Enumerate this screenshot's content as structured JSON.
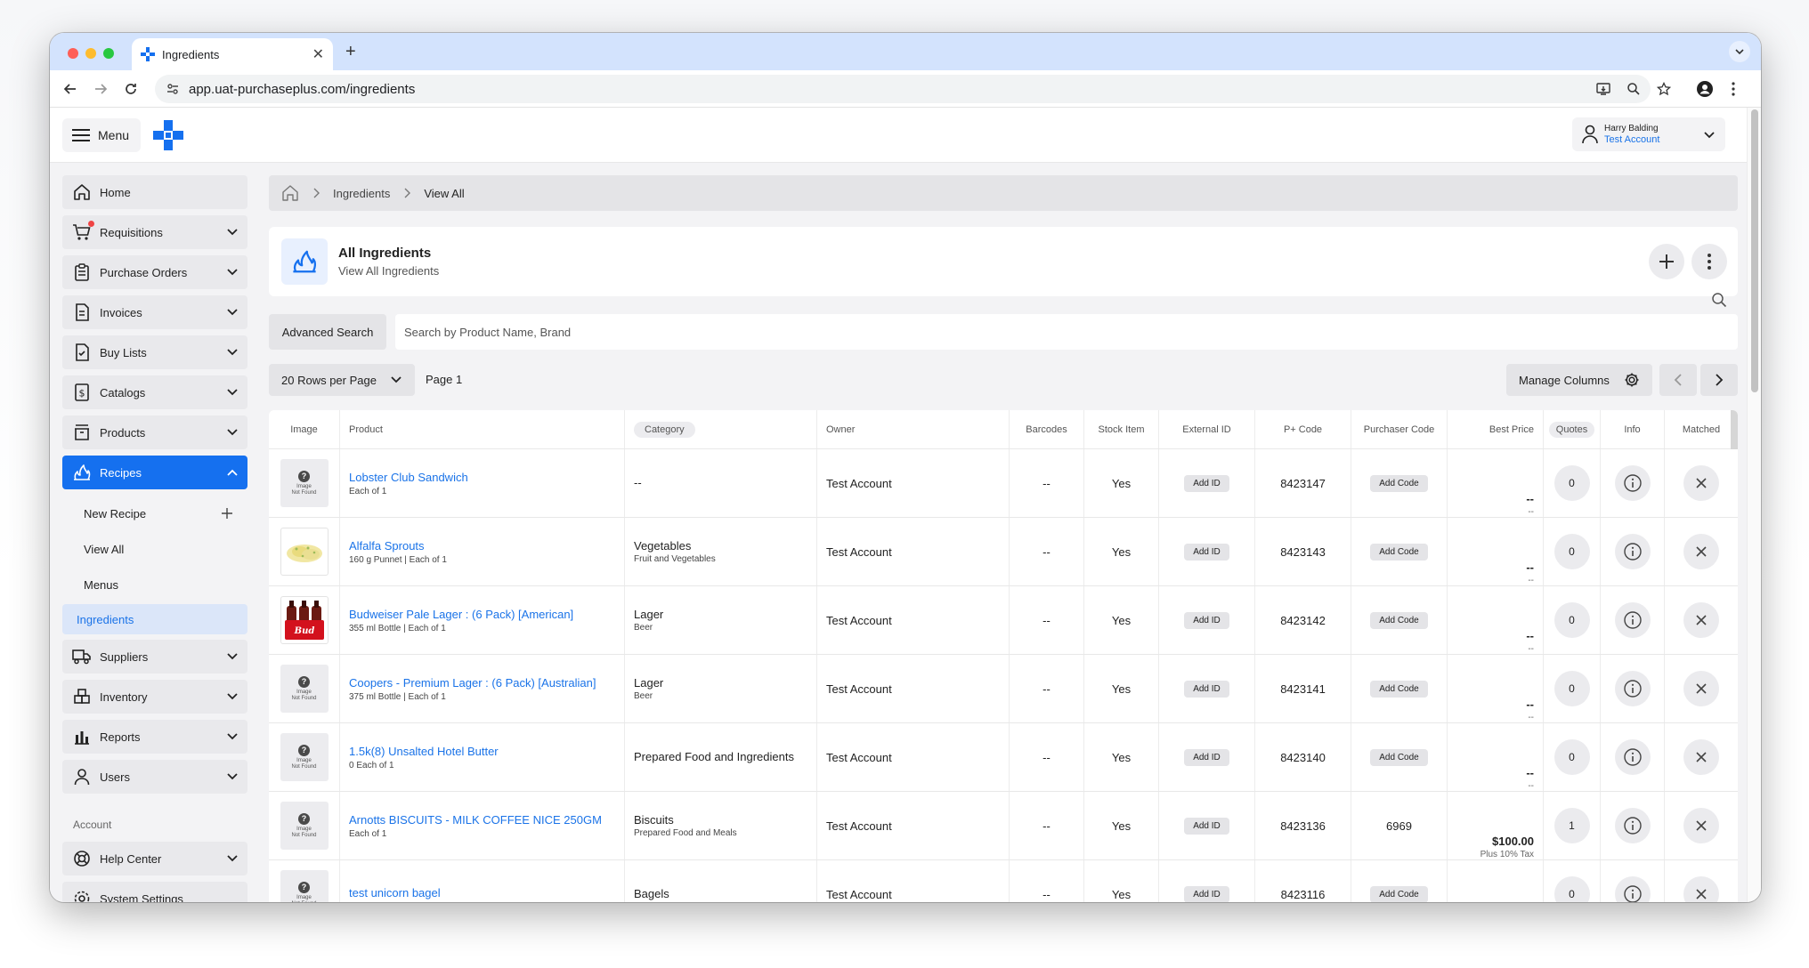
{
  "browser": {
    "tab_title": "Ingredients",
    "url": "app.uat-purchaseplus.com/ingredients"
  },
  "header": {
    "menu_label": "Menu",
    "user_name": "Harry Balding",
    "user_account": "Test Account"
  },
  "sidebar": {
    "items": [
      {
        "label": "Home",
        "icon": "home-icon"
      },
      {
        "label": "Requisitions",
        "icon": "cart-icon"
      },
      {
        "label": "Purchase Orders",
        "icon": "clipboard-icon"
      },
      {
        "label": "Invoices",
        "icon": "invoice-icon"
      },
      {
        "label": "Buy Lists",
        "icon": "checklist-icon"
      },
      {
        "label": "Catalogs",
        "icon": "dollar-doc-icon"
      },
      {
        "label": "Products",
        "icon": "box-icon"
      },
      {
        "label": "Recipes",
        "icon": "flame-icon"
      },
      {
        "label": "Suppliers",
        "icon": "truck-icon"
      },
      {
        "label": "Inventory",
        "icon": "boxes-icon"
      },
      {
        "label": "Reports",
        "icon": "bar-chart-icon"
      },
      {
        "label": "Users",
        "icon": "user-icon"
      }
    ],
    "recipes_sub": [
      "New Recipe",
      "View All",
      "Menus",
      "Ingredients"
    ],
    "account_section": "Account",
    "help_center": "Help Center",
    "partial_item": "System Settings"
  },
  "breadcrumb": {
    "level1": "Ingredients",
    "level2": "View All"
  },
  "page": {
    "title": "All Ingredients",
    "subtitle": "View All Ingredients"
  },
  "search": {
    "advanced_label": "Advanced Search",
    "placeholder": "Search by Product Name, Brand"
  },
  "pagination": {
    "rows_label": "20 Rows per Page",
    "page_label": "Page 1",
    "manage_columns": "Manage Columns"
  },
  "table": {
    "columns": {
      "image": "Image",
      "product": "Product",
      "category": "Category",
      "owner": "Owner",
      "barcodes": "Barcodes",
      "stock": "Stock Item",
      "external_id": "External ID",
      "pcode": "P+ Code",
      "purchaser_code": "Purchaser Code",
      "best_price": "Best Price",
      "quotes": "Quotes",
      "info": "Info",
      "matched": "Matched"
    },
    "rows": [
      {
        "image": "not-found",
        "name": "Lobster Club Sandwich",
        "sub": "Each of 1",
        "category": "--",
        "category_sub": "",
        "owner": "Test Account",
        "barcodes": "--",
        "stock": "Yes",
        "external": "Add ID",
        "pcode": "8423147",
        "purchaser": "Add Code",
        "price": "--",
        "price_sub": "--",
        "quotes": "0"
      },
      {
        "image": "alfalfa",
        "name": "Alfalfa Sprouts",
        "sub": "160 g Punnet | Each of 1",
        "category": "Vegetables",
        "category_sub": "Fruit and Vegetables",
        "owner": "Test Account",
        "barcodes": "--",
        "stock": "Yes",
        "external": "Add ID",
        "pcode": "8423143",
        "purchaser": "Add Code",
        "price": "--",
        "price_sub": "--",
        "quotes": "0"
      },
      {
        "image": "budweiser",
        "name": "Budweiser Pale Lager : (6 Pack) [American]",
        "sub": "355 ml Bottle | Each of 1",
        "category": "Lager",
        "category_sub": "Beer",
        "owner": "Test Account",
        "barcodes": "--",
        "stock": "Yes",
        "external": "Add ID",
        "pcode": "8423142",
        "purchaser": "Add Code",
        "price": "--",
        "price_sub": "--",
        "quotes": "0"
      },
      {
        "image": "not-found",
        "name": "Coopers - Premium Lager : (6 Pack) [Australian]",
        "sub": "375 ml Bottle | Each of 1",
        "category": "Lager",
        "category_sub": "Beer",
        "owner": "Test Account",
        "barcodes": "--",
        "stock": "Yes",
        "external": "Add ID",
        "pcode": "8423141",
        "purchaser": "Add Code",
        "price": "--",
        "price_sub": "--",
        "quotes": "0"
      },
      {
        "image": "not-found",
        "name": "1.5k(8) Unsalted Hotel Butter",
        "sub": "0 Each of 1",
        "category": "Prepared Food and Ingredients",
        "category_sub": "",
        "owner": "Test Account",
        "barcodes": "--",
        "stock": "Yes",
        "external": "Add ID",
        "pcode": "8423140",
        "purchaser": "Add Code",
        "price": "--",
        "price_sub": "--",
        "quotes": "0"
      },
      {
        "image": "not-found",
        "name": "Arnotts BISCUITS - MILK COFFEE NICE 250GM",
        "sub": "Each of 1",
        "category": "Biscuits",
        "category_sub": "Prepared Food and Meals",
        "owner": "Test Account",
        "barcodes": "--",
        "stock": "Yes",
        "external": "Add ID",
        "pcode": "8423136",
        "purchaser": "6969",
        "price": "$100.00",
        "price_sub": "Plus 10% Tax",
        "quotes": "1"
      },
      {
        "image": "not-found",
        "name": "test unicorn bagel",
        "sub": "",
        "category": "Bagels",
        "category_sub": "",
        "owner": "Test Account",
        "barcodes": "--",
        "stock": "Yes",
        "external": "Add ID",
        "pcode": "8423116",
        "purchaser": "Add Code",
        "price": "--",
        "price_sub": "",
        "quotes": "0"
      }
    ],
    "image_not_found_line1": "Image",
    "image_not_found_line2": "Not Found"
  },
  "colors": {
    "accent": "#1570ef",
    "link": "#1a73e8",
    "tabstrip": "#d3e3fd"
  }
}
